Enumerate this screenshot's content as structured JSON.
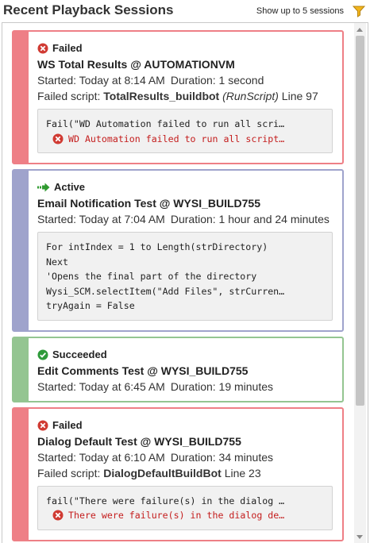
{
  "header": {
    "title": "Recent Playback Sessions",
    "limit_label": "Show up to 5 sessions"
  },
  "colors": {
    "failed": "#ee7f86",
    "active": "#9fa3cc",
    "succeeded": "#94c591",
    "error_text": "#c41d1d"
  },
  "sessions": [
    {
      "status": "Failed",
      "status_icon": "error-x-icon",
      "name": "WS Total Results @ AUTOMATIONVM",
      "started": "Started: Today at 8:14 AM",
      "duration": "Duration: 1 second",
      "failed_label": "Failed script:",
      "failed_script": "TotalResults_buildbot",
      "failed_type": "(RunScript)",
      "failed_line": "Line 97",
      "code": "Fail(\"WD Automation failed to run all scri…",
      "error": "WD Automation failed to run all script…"
    },
    {
      "status": "Active",
      "status_icon": "running-arrow-icon",
      "name": "Email Notification Test @ WYSI_BUILD755",
      "started": "Started: Today at 7:04 AM",
      "duration": "Duration: 1 hour and 24 minutes",
      "code_lines": [
        "For intIndex = 1 to Length(strDirectory)",
        "Next",
        "'Opens the final part of the directory",
        "Wysi_SCM.selectItem(\"Add Files\", strCurren…",
        "tryAgain = False"
      ]
    },
    {
      "status": "Succeeded",
      "status_icon": "check-circle-icon",
      "name": "Edit Comments Test @ WYSI_BUILD755",
      "started": "Started: Today at 6:45 AM",
      "duration": "Duration: 19 minutes"
    },
    {
      "status": "Failed",
      "status_icon": "error-x-icon",
      "name": "Dialog Default Test @ WYSI_BUILD755",
      "started": "Started: Today at 6:10 AM",
      "duration": "Duration: 34 minutes",
      "failed_label": "Failed script:",
      "failed_script": "DialogDefaultBuildBot",
      "failed_line": "Line 23",
      "code": "fail(\"There were failure(s) in the dialog …",
      "error": "There were failure(s) in the dialog de…"
    }
  ]
}
